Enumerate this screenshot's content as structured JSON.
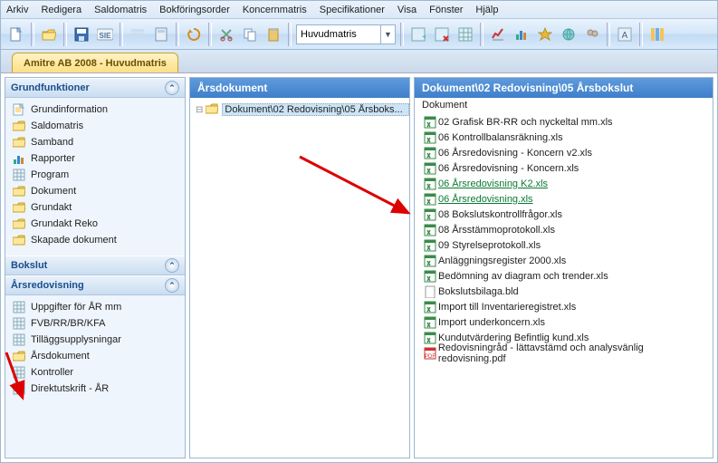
{
  "menu": {
    "items": [
      "Arkiv",
      "Redigera",
      "Saldomatris",
      "Bokföringsorder",
      "Koncernmatris",
      "Specifikationer",
      "Visa",
      "Fönster",
      "Hjälp"
    ]
  },
  "toolbar": {
    "combo_value": "Huvudmatris"
  },
  "doc_tab": "Amitre AB 2008 - Huvudmatris",
  "sidebar": {
    "groups": [
      {
        "title": "Grundfunktioner",
        "items": [
          {
            "icon": "note",
            "label": "Grundinformation"
          },
          {
            "icon": "folder",
            "label": "Saldomatris"
          },
          {
            "icon": "folder",
            "label": "Samband"
          },
          {
            "icon": "chart",
            "label": "Rapporter"
          },
          {
            "icon": "sheet",
            "label": "Program"
          },
          {
            "icon": "folder",
            "label": "Dokument"
          },
          {
            "icon": "folder",
            "label": "Grundakt"
          },
          {
            "icon": "folder",
            "label": "Grundakt Reko"
          },
          {
            "icon": "folder",
            "label": "Skapade dokument"
          }
        ]
      },
      {
        "title": "Bokslut",
        "items": []
      },
      {
        "title": "Årsredovisning",
        "items": [
          {
            "icon": "sheet",
            "label": "Uppgifter för ÅR mm"
          },
          {
            "icon": "sheet",
            "label": "FVB/RR/BR/KFA"
          },
          {
            "icon": "sheet",
            "label": "Tilläggsupplysningar"
          },
          {
            "icon": "folder",
            "label": "Årsdokument",
            "sel": true
          },
          {
            "icon": "sheet",
            "label": "Kontroller"
          },
          {
            "icon": "sheet",
            "label": "Direktutskrift - ÅR"
          }
        ]
      }
    ]
  },
  "tree": {
    "header": "Årsdokument",
    "node": "Dokument\\02 Redovisning\\05 Årsboks..."
  },
  "files": {
    "header": "Dokument\\02 Redovisning\\05 Årsbokslut",
    "column": "Dokument",
    "items": [
      {
        "icon": "xls",
        "label": "02 Grafisk BR-RR och nyckeltal mm.xls"
      },
      {
        "icon": "xls",
        "label": "06 Kontrollbalansräkning.xls"
      },
      {
        "icon": "xls",
        "label": "06 Årsredovisning - Koncern v2.xls"
      },
      {
        "icon": "xls",
        "label": "06 Årsredovisning - Koncern.xls"
      },
      {
        "icon": "xls",
        "label": "06 Årsredovisning K2.xls",
        "link": true
      },
      {
        "icon": "xls",
        "label": "06 Årsredovisning.xls",
        "link": true
      },
      {
        "icon": "xls",
        "label": "08 Bokslutskontrollfrågor.xls"
      },
      {
        "icon": "xls",
        "label": "08 Årsstämmoprotokoll.xls"
      },
      {
        "icon": "xls",
        "label": "09 Styrelseprotokoll.xls"
      },
      {
        "icon": "xls",
        "label": "Anläggningsregister 2000.xls"
      },
      {
        "icon": "xls",
        "label": "Bedömning av diagram och trender.xls"
      },
      {
        "icon": "file",
        "label": "Bokslutsbilaga.bld"
      },
      {
        "icon": "xls",
        "label": "Import till Inventarieregistret.xls"
      },
      {
        "icon": "xls",
        "label": "Import underkoncern.xls"
      },
      {
        "icon": "xls",
        "label": "Kundutvärdering Befintlig kund.xls"
      },
      {
        "icon": "pdf",
        "label": "Redovisningråd - lättavstämd och analysvänlig redovisning.pdf"
      }
    ]
  }
}
